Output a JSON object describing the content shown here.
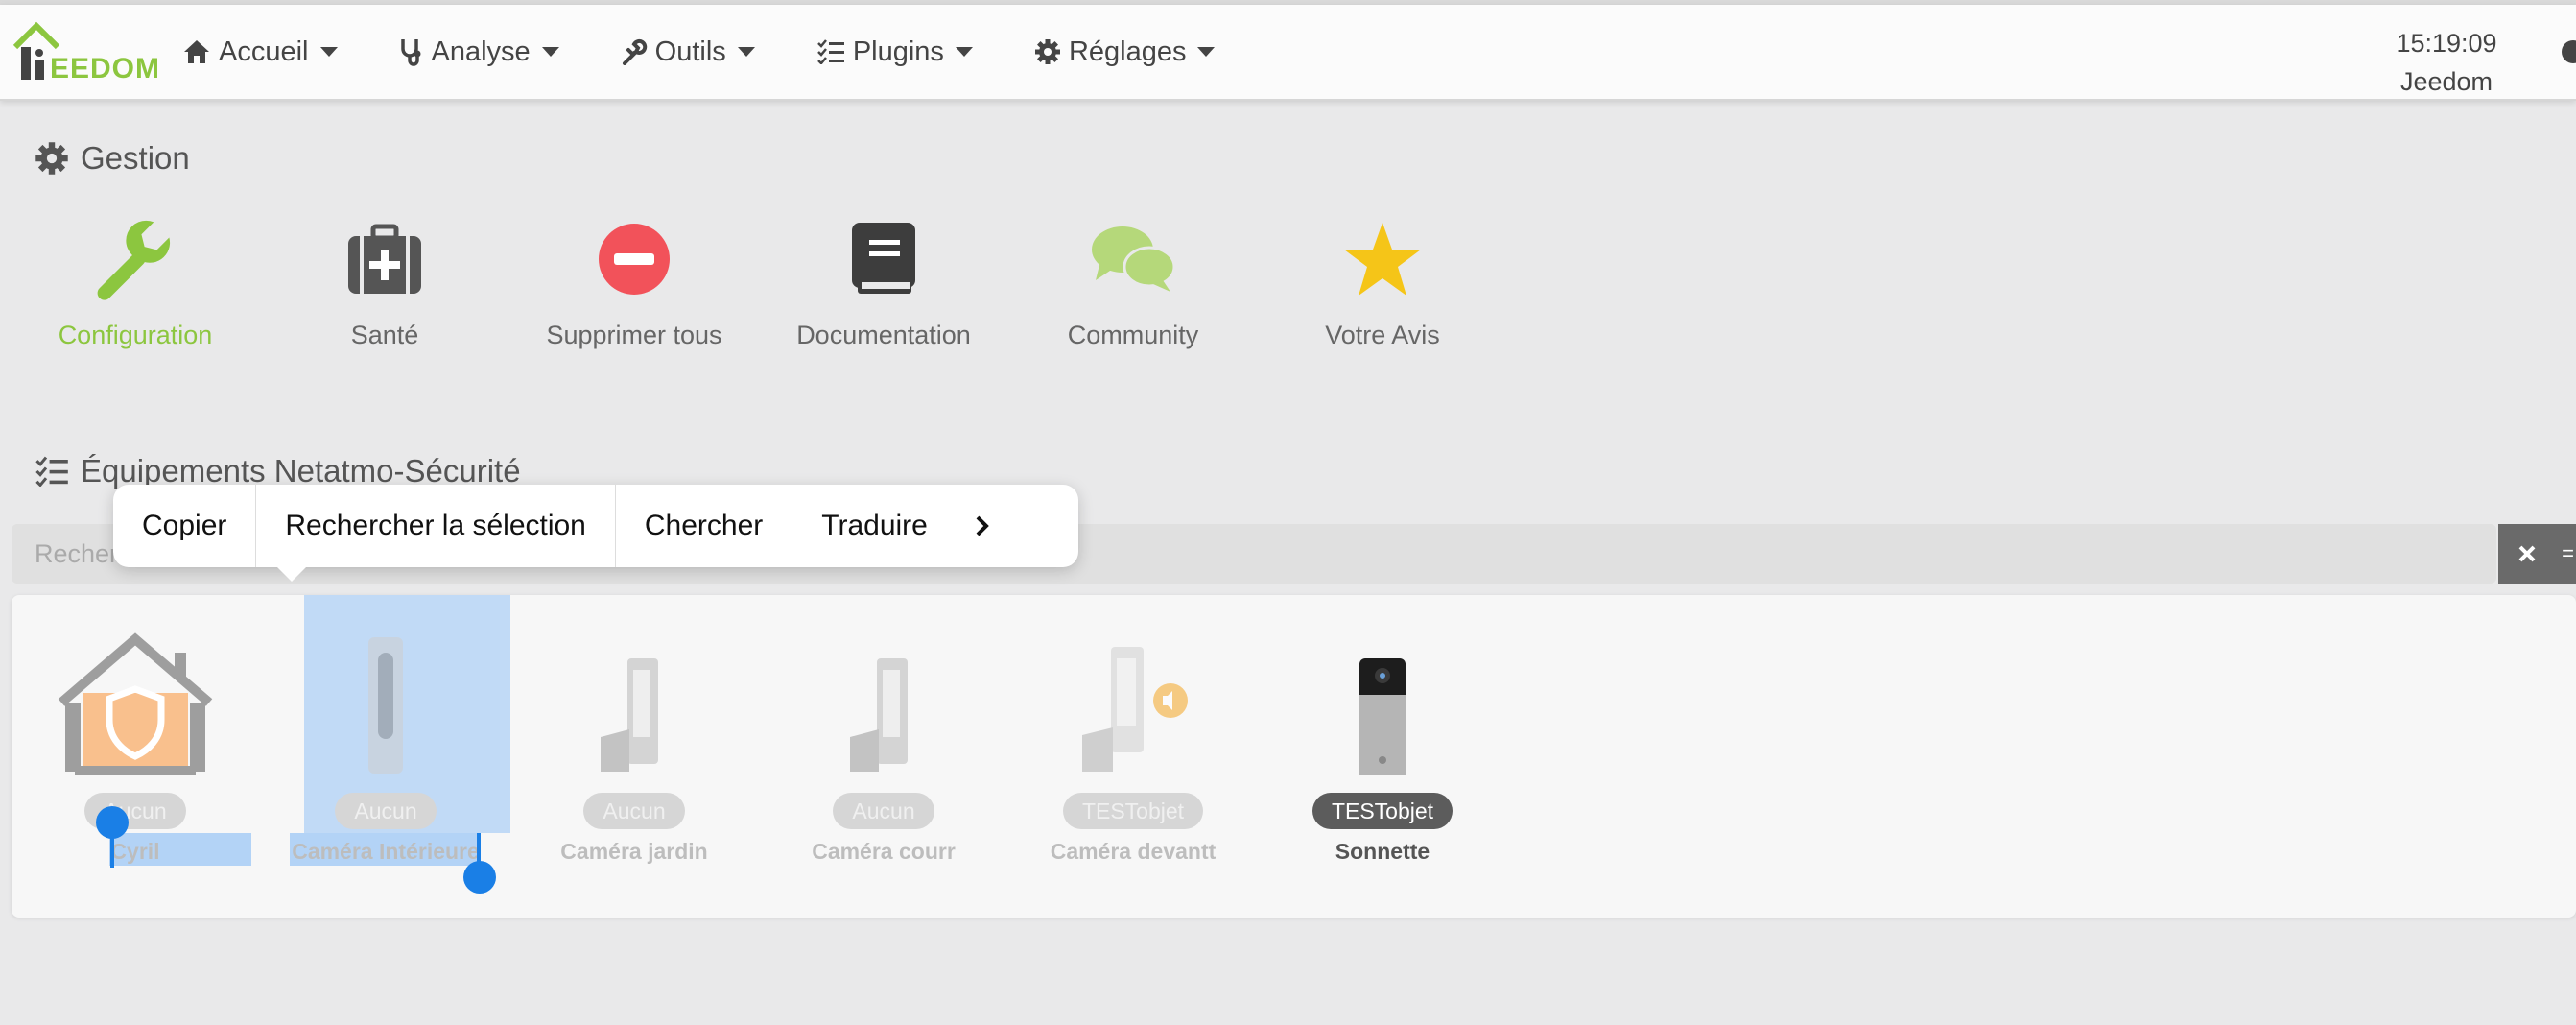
{
  "brand": {
    "logo_text": "EEDOM",
    "accent": "#8cc63f"
  },
  "nav": {
    "items": [
      {
        "label": "Accueil",
        "icon": "home-icon"
      },
      {
        "label": "Analyse",
        "icon": "stethoscope-icon"
      },
      {
        "label": "Outils",
        "icon": "wrench-icon"
      },
      {
        "label": "Plugins",
        "icon": "tasks-icon"
      },
      {
        "label": "Réglages",
        "icon": "gear-icon"
      }
    ],
    "time": "15:19:09",
    "user": "Jeedom"
  },
  "gestion": {
    "title": "Gestion",
    "items": [
      {
        "label": "Configuration",
        "icon": "wrench-icon",
        "color": "#8cc63f"
      },
      {
        "label": "Santé",
        "icon": "medkit-icon",
        "color": "#555555"
      },
      {
        "label": "Supprimer tous",
        "icon": "minus-circle-icon",
        "color": "#f2525a"
      },
      {
        "label": "Documentation",
        "icon": "book-icon",
        "color": "#3d3d3d"
      },
      {
        "label": "Community",
        "icon": "comments-icon",
        "color": "#b5d87a"
      },
      {
        "label": "Votre Avis",
        "icon": "star-icon",
        "color": "#f5c518"
      }
    ]
  },
  "equipments": {
    "title": "Équipements Netatmo-Sécurité",
    "search_placeholder": "Rechercher",
    "clear_icon": "times-icon",
    "items": [
      {
        "badge": "Aucun",
        "name": "Cyril",
        "image": "home-shield-icon"
      },
      {
        "badge": "Aucun",
        "name": "Caméra Intérieure",
        "image": "indoor-camera-icon"
      },
      {
        "badge": "Aucun",
        "name": "Caméra jardin",
        "image": "outdoor-camera-icon"
      },
      {
        "badge": "Aucun",
        "name": "Caméra courr",
        "image": "outdoor-camera-icon"
      },
      {
        "badge": "TESTobjet",
        "name": "Caméra devantt",
        "image": "siren-camera-icon"
      },
      {
        "badge": "TESTobjet",
        "name": "Sonnette",
        "image": "doorbell-icon"
      }
    ]
  },
  "context_menu": {
    "items": [
      "Copier",
      "Rechercher la sélection",
      "Chercher",
      "Traduire"
    ],
    "more_icon": "chevron-right-icon"
  }
}
